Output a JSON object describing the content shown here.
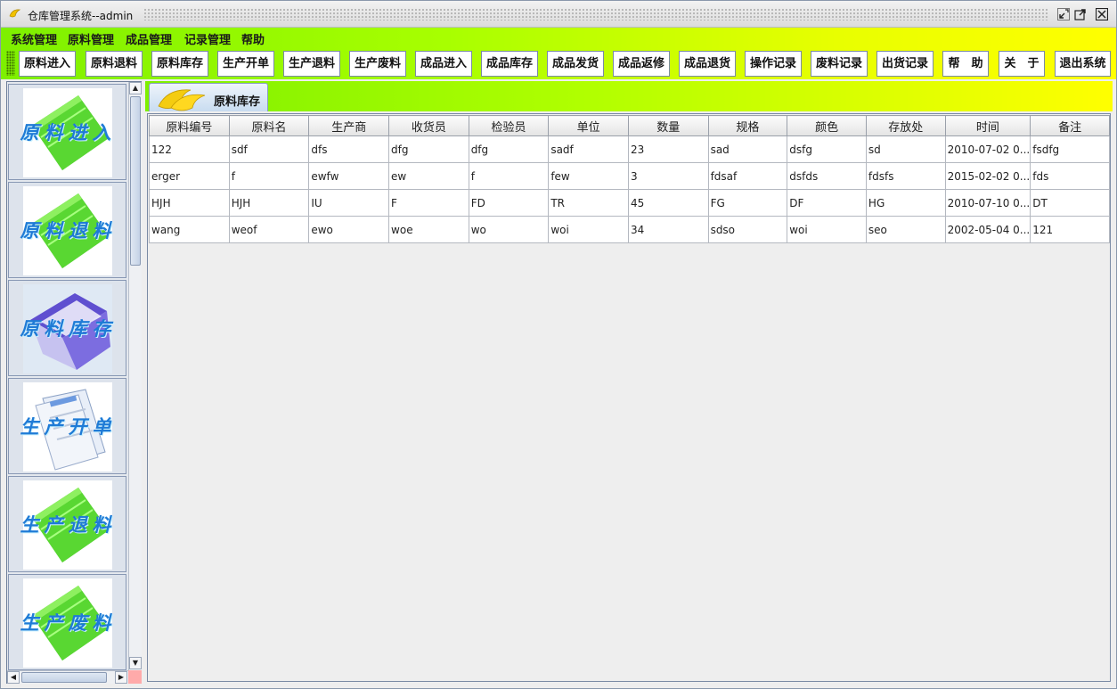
{
  "window": {
    "title": "仓库管理系统--admin"
  },
  "menubar": {
    "items": [
      "系统管理",
      "原料管理",
      "成品管理",
      "记录管理",
      "帮助"
    ]
  },
  "toolbar": {
    "buttons": [
      "原料进入",
      "原料退料",
      "原料库存",
      "生产开单",
      "生产退料",
      "生产废料",
      "成品进入",
      "成品库存",
      "成品发货",
      "成品返修",
      "成品退货",
      "操作记录",
      "废料记录",
      "出货记录",
      "帮　助",
      "关　于",
      "退出系统"
    ]
  },
  "sidebar": {
    "items": [
      {
        "label": "原料进入",
        "icon": "green-book-icon"
      },
      {
        "label": "原料退料",
        "icon": "green-book-icon"
      },
      {
        "label": "原料库存",
        "icon": "purple-folder-icon"
      },
      {
        "label": "生产开单",
        "icon": "document-stack-icon"
      },
      {
        "label": "生产退料",
        "icon": "green-book-icon"
      },
      {
        "label": "生产废料",
        "icon": "green-book-icon"
      }
    ]
  },
  "tab": {
    "label": "原料库存",
    "icon": "banana-icon"
  },
  "table": {
    "columns": [
      "原料编号",
      "原料名",
      "生产商",
      "收货员",
      "检验员",
      "单位",
      "数量",
      "规格",
      "颜色",
      "存放处",
      "时间",
      "备注"
    ],
    "rows": [
      [
        "122",
        "sdf",
        "dfs",
        "dfg",
        "dfg",
        "sadf",
        "23",
        "sad",
        "dsfg",
        "sd",
        "2010-07-02 0...",
        "fsdfg"
      ],
      [
        "erger",
        "f",
        "ewfw",
        "ew",
        "f",
        "few",
        "3",
        "fdsaf",
        "dsfds",
        "fdsfs",
        "2015-02-02 0...",
        "fds"
      ],
      [
        "HJH",
        "HJH",
        "IU",
        "F",
        "FD",
        "TR",
        "45",
        "FG",
        "DF",
        "HG",
        "2010-07-10 0...",
        "DT"
      ],
      [
        "wang",
        "weof",
        "ewo",
        "woe",
        "wo",
        "woi",
        "34",
        "sdso",
        "woi",
        "seo",
        "2002-05-04 0...",
        "121"
      ]
    ]
  },
  "colors": {
    "toolbar_gradient_start": "#7ef000",
    "toolbar_gradient_end": "#ffff00",
    "sidebar_label": "#1f7bd6"
  }
}
